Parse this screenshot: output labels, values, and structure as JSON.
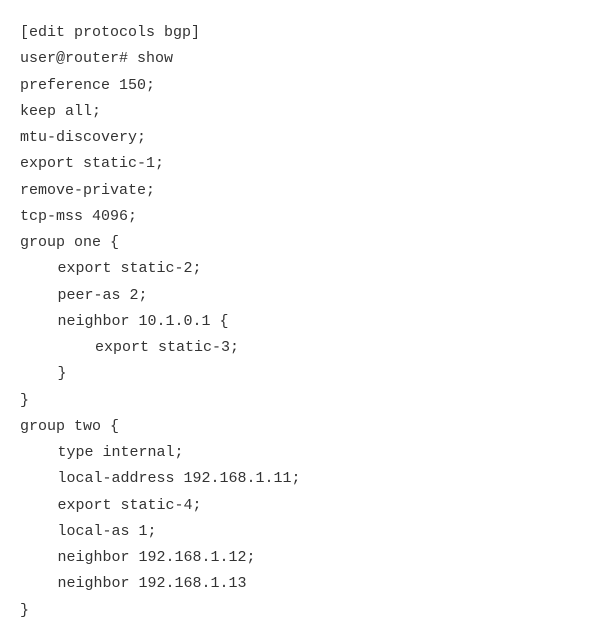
{
  "lines": {
    "l0": "[edit protocols bgp]",
    "l1": "user@router# show",
    "l2": "preference 150;",
    "l3": "keep all;",
    "l4": "mtu-discovery;",
    "l5": "export static-1;",
    "l6": "remove-private;",
    "l7": "tcp-mss 4096;",
    "l8": "group one {",
    "l9": "export static-2;",
    "l10": "peer-as 2;",
    "l11": "neighbor 10.1.0.1 {",
    "l12": "export static-3;",
    "l13": "}",
    "l14": "}",
    "l15": "group two {",
    "l16": "type internal;",
    "l17": "local-address 192.168.1.11;",
    "l18": "export static-4;",
    "l19": "local-as 1;",
    "l20": "neighbor 192.168.1.12;",
    "l21": "neighbor 192.168.1.13",
    "l22": "}"
  }
}
